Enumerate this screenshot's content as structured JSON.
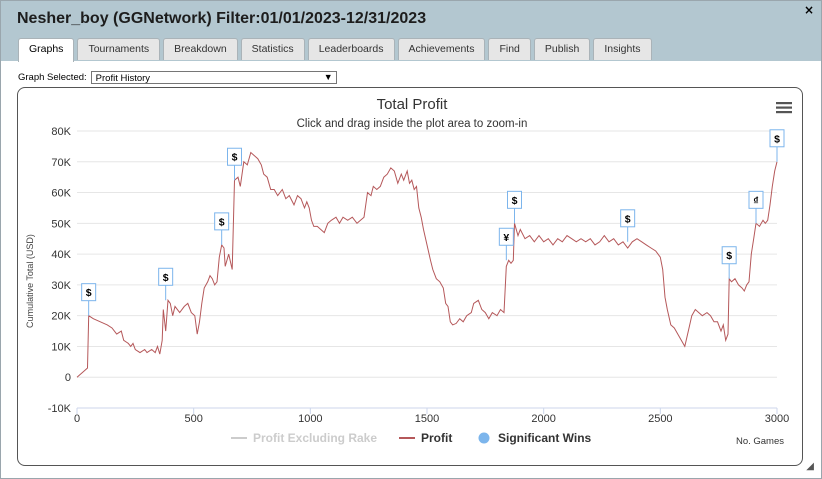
{
  "window": {
    "title": "Nesher_boy (GGNetwork) Filter:01/01/2023-12/31/2023",
    "close_label": "×"
  },
  "tabs": [
    "Graphs",
    "Tournaments",
    "Breakdown",
    "Statistics",
    "Leaderboards",
    "Achievements",
    "Find",
    "Publish",
    "Insights"
  ],
  "active_tab": "Graphs",
  "graph_selector": {
    "label": "Graph Selected:",
    "value": "Profit History"
  },
  "menu_icon": "hamburger-menu-icon",
  "chart_data": {
    "type": "line",
    "title": "Total Profit",
    "subtitle": "Click and drag inside the plot area to zoom-in",
    "ylabel": "Cumulative Total (USD)",
    "xlabel": "No. Games",
    "ylim": [
      -10000,
      80000
    ],
    "xlim": [
      0,
      3000
    ],
    "y_ticks": [
      -10000,
      0,
      10000,
      20000,
      30000,
      40000,
      50000,
      60000,
      70000,
      80000
    ],
    "y_tick_labels": [
      "-10K",
      "0",
      "10K",
      "20K",
      "30K",
      "40K",
      "50K",
      "60K",
      "70K",
      "80K"
    ],
    "x_ticks": [
      0,
      500,
      1000,
      1500,
      2000,
      2500,
      3000
    ],
    "x_tick_labels": [
      "0",
      "500",
      "1000",
      "1500",
      "2000",
      "2500",
      "3000"
    ],
    "legend": [
      {
        "name": "Profit Excluding Rake",
        "color": "#cccccc",
        "symbol": "line"
      },
      {
        "name": "Profit",
        "color": "#b5585a",
        "symbol": "line"
      },
      {
        "name": "Significant Wins",
        "color": "#7cb5ec",
        "symbol": "circle"
      }
    ],
    "series": [
      {
        "name": "Profit",
        "color": "#b5585a",
        "points": [
          [
            0,
            0
          ],
          [
            30,
            2000
          ],
          [
            45,
            3000
          ],
          [
            50,
            20000
          ],
          [
            70,
            19000
          ],
          [
            100,
            18000
          ],
          [
            130,
            17000
          ],
          [
            150,
            16000
          ],
          [
            170,
            14000
          ],
          [
            190,
            15000
          ],
          [
            200,
            12000
          ],
          [
            220,
            11000
          ],
          [
            230,
            10000
          ],
          [
            240,
            11000
          ],
          [
            250,
            9000
          ],
          [
            270,
            8000
          ],
          [
            290,
            9000
          ],
          [
            300,
            8000
          ],
          [
            320,
            9000
          ],
          [
            335,
            8000
          ],
          [
            345,
            10000
          ],
          [
            355,
            7500
          ],
          [
            365,
            12000
          ],
          [
            370,
            22000
          ],
          [
            380,
            15000
          ],
          [
            390,
            25000
          ],
          [
            400,
            24000
          ],
          [
            410,
            20000
          ],
          [
            420,
            23000
          ],
          [
            440,
            21000
          ],
          [
            460,
            23000
          ],
          [
            475,
            24000
          ],
          [
            490,
            21000
          ],
          [
            505,
            20000
          ],
          [
            515,
            14000
          ],
          [
            525,
            18000
          ],
          [
            535,
            24000
          ],
          [
            545,
            29000
          ],
          [
            560,
            31000
          ],
          [
            570,
            33000
          ],
          [
            580,
            32000
          ],
          [
            590,
            30000
          ],
          [
            600,
            31000
          ],
          [
            610,
            39000
          ],
          [
            620,
            43000
          ],
          [
            630,
            42000
          ],
          [
            635,
            36000
          ],
          [
            650,
            40000
          ],
          [
            665,
            35000
          ],
          [
            675,
            64000
          ],
          [
            690,
            65000
          ],
          [
            700,
            62000
          ],
          [
            715,
            70000
          ],
          [
            730,
            69000
          ],
          [
            745,
            73000
          ],
          [
            760,
            72000
          ],
          [
            775,
            71000
          ],
          [
            790,
            69000
          ],
          [
            800,
            66000
          ],
          [
            815,
            65000
          ],
          [
            830,
            61000
          ],
          [
            845,
            61000
          ],
          [
            860,
            59000
          ],
          [
            880,
            61000
          ],
          [
            895,
            58000
          ],
          [
            910,
            59000
          ],
          [
            930,
            56000
          ],
          [
            945,
            59000
          ],
          [
            960,
            58000
          ],
          [
            975,
            55000
          ],
          [
            985,
            57000
          ],
          [
            995,
            55000
          ],
          [
            1005,
            51000
          ],
          [
            1015,
            49000
          ],
          [
            1030,
            49000
          ],
          [
            1045,
            48000
          ],
          [
            1060,
            47000
          ],
          [
            1075,
            50000
          ],
          [
            1090,
            51000
          ],
          [
            1110,
            52000
          ],
          [
            1125,
            50000
          ],
          [
            1140,
            52000
          ],
          [
            1160,
            51000
          ],
          [
            1180,
            52000
          ],
          [
            1200,
            50000
          ],
          [
            1215,
            51000
          ],
          [
            1230,
            52000
          ],
          [
            1245,
            60000
          ],
          [
            1260,
            59000
          ],
          [
            1270,
            62000
          ],
          [
            1285,
            61000
          ],
          [
            1300,
            62000
          ],
          [
            1315,
            65000
          ],
          [
            1330,
            66000
          ],
          [
            1345,
            68000
          ],
          [
            1360,
            67000
          ],
          [
            1375,
            63000
          ],
          [
            1390,
            66000
          ],
          [
            1400,
            64000
          ],
          [
            1415,
            67000
          ],
          [
            1425,
            63000
          ],
          [
            1435,
            64000
          ],
          [
            1445,
            61000
          ],
          [
            1455,
            62000
          ],
          [
            1465,
            55000
          ],
          [
            1475,
            52000
          ],
          [
            1485,
            48000
          ],
          [
            1500,
            43000
          ],
          [
            1515,
            38000
          ],
          [
            1525,
            35000
          ],
          [
            1540,
            32000
          ],
          [
            1555,
            31000
          ],
          [
            1570,
            29000
          ],
          [
            1580,
            24000
          ],
          [
            1590,
            23000
          ],
          [
            1600,
            18000
          ],
          [
            1610,
            17000
          ],
          [
            1625,
            17500
          ],
          [
            1640,
            19000
          ],
          [
            1655,
            18000
          ],
          [
            1670,
            20000
          ],
          [
            1690,
            21000
          ],
          [
            1700,
            24000
          ],
          [
            1720,
            25000
          ],
          [
            1735,
            22000
          ],
          [
            1750,
            21000
          ],
          [
            1765,
            19000
          ],
          [
            1780,
            21000
          ],
          [
            1800,
            20000
          ],
          [
            1815,
            22000
          ],
          [
            1830,
            21000
          ],
          [
            1840,
            36000
          ],
          [
            1850,
            38000
          ],
          [
            1860,
            37000
          ],
          [
            1870,
            38000
          ],
          [
            1875,
            50000
          ],
          [
            1890,
            46000
          ],
          [
            1900,
            48000
          ],
          [
            1920,
            45000
          ],
          [
            1940,
            46000
          ],
          [
            1960,
            44000
          ],
          [
            1980,
            46000
          ],
          [
            2000,
            44000
          ],
          [
            2020,
            45000
          ],
          [
            2040,
            43000
          ],
          [
            2060,
            45000
          ],
          [
            2080,
            44000
          ],
          [
            2100,
            46000
          ],
          [
            2120,
            45000
          ],
          [
            2140,
            44000
          ],
          [
            2160,
            45000
          ],
          [
            2180,
            44000
          ],
          [
            2200,
            45000
          ],
          [
            2220,
            43000
          ],
          [
            2240,
            44000
          ],
          [
            2260,
            46000
          ],
          [
            2280,
            44000
          ],
          [
            2300,
            45000
          ],
          [
            2320,
            43000
          ],
          [
            2340,
            44000
          ],
          [
            2360,
            42000
          ],
          [
            2380,
            44000
          ],
          [
            2400,
            45000
          ],
          [
            2420,
            44000
          ],
          [
            2440,
            43000
          ],
          [
            2460,
            42000
          ],
          [
            2480,
            41000
          ],
          [
            2490,
            40000
          ],
          [
            2500,
            39000
          ],
          [
            2510,
            35000
          ],
          [
            2520,
            26000
          ],
          [
            2530,
            22000
          ],
          [
            2545,
            17000
          ],
          [
            2560,
            16000
          ],
          [
            2575,
            14000
          ],
          [
            2590,
            12000
          ],
          [
            2605,
            10000
          ],
          [
            2620,
            15000
          ],
          [
            2635,
            20000
          ],
          [
            2650,
            22000
          ],
          [
            2665,
            21000
          ],
          [
            2680,
            20000
          ],
          [
            2700,
            21000
          ],
          [
            2715,
            20000
          ],
          [
            2730,
            18000
          ],
          [
            2745,
            18000
          ],
          [
            2760,
            15000
          ],
          [
            2770,
            17000
          ],
          [
            2780,
            12000
          ],
          [
            2790,
            14000
          ],
          [
            2795,
            32000
          ],
          [
            2805,
            31000
          ],
          [
            2820,
            32000
          ],
          [
            2835,
            30000
          ],
          [
            2850,
            29000
          ],
          [
            2860,
            28000
          ],
          [
            2870,
            30000
          ],
          [
            2880,
            31000
          ],
          [
            2890,
            40000
          ],
          [
            2900,
            45000
          ],
          [
            2910,
            50000
          ],
          [
            2925,
            49000
          ],
          [
            2940,
            51000
          ],
          [
            2950,
            50000
          ],
          [
            2960,
            51000
          ],
          [
            2970,
            56000
          ],
          [
            2980,
            62000
          ],
          [
            2990,
            67000
          ],
          [
            3000,
            70000
          ]
        ]
      }
    ],
    "significant_wins": [
      {
        "x": 50,
        "y": 20000,
        "label": "$"
      },
      {
        "x": 380,
        "y": 25000,
        "label": "$"
      },
      {
        "x": 620,
        "y": 43000,
        "label": "$"
      },
      {
        "x": 675,
        "y": 64000,
        "label": "$"
      },
      {
        "x": 1840,
        "y": 38000,
        "label": "¥"
      },
      {
        "x": 1875,
        "y": 50000,
        "label": "$"
      },
      {
        "x": 2360,
        "y": 44000,
        "label": "$"
      },
      {
        "x": 2795,
        "y": 32000,
        "label": "$"
      },
      {
        "x": 2910,
        "y": 50000,
        "label": "₫"
      },
      {
        "x": 3000,
        "y": 70000,
        "label": "$"
      }
    ]
  }
}
